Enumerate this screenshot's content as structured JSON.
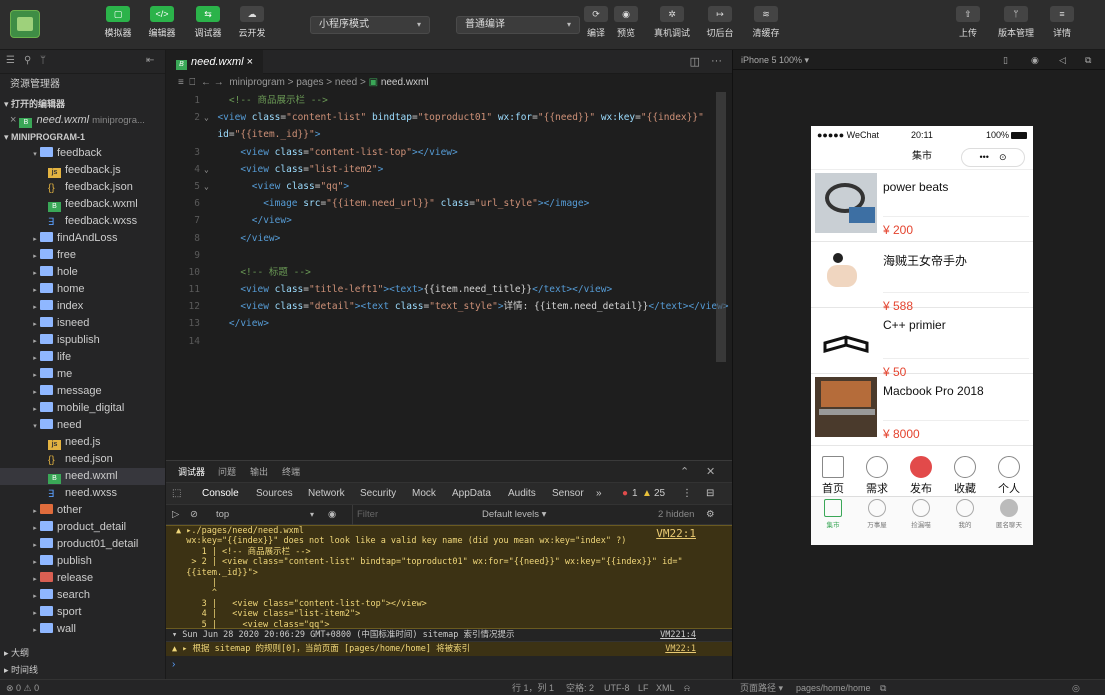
{
  "toolbar": {
    "buttons": [
      "模拟器",
      "编辑器",
      "调试器",
      "云开发"
    ],
    "mode_select": "小程序模式",
    "compile_select": "普通编译",
    "right_buttons": [
      "编译",
      "预览",
      "真机调试",
      "切后台",
      "清缓存"
    ],
    "far_right": [
      "上传",
      "版本管理",
      "详情"
    ]
  },
  "sidebar": {
    "title": "资源管理器",
    "open_editors": "打开的编辑器",
    "open_file": "need.wxml",
    "open_file_path": "miniprogra...",
    "project": "MINIPROGRAM-1",
    "tree": [
      {
        "label": "feedback",
        "kind": "folder",
        "arrow": "▾",
        "depth": 1
      },
      {
        "label": "feedback.js",
        "kind": "js",
        "depth": 2
      },
      {
        "label": "feedback.json",
        "kind": "json",
        "depth": 2
      },
      {
        "label": "feedback.wxml",
        "kind": "wxml",
        "depth": 2
      },
      {
        "label": "feedback.wxss",
        "kind": "wxss",
        "depth": 2
      },
      {
        "label": "findAndLoss",
        "kind": "folder",
        "arrow": "▸",
        "depth": 1
      },
      {
        "label": "free",
        "kind": "folder",
        "arrow": "▸",
        "depth": 1
      },
      {
        "label": "hole",
        "kind": "folder",
        "arrow": "▸",
        "depth": 1
      },
      {
        "label": "home",
        "kind": "folder",
        "arrow": "▸",
        "depth": 1
      },
      {
        "label": "index",
        "kind": "folder",
        "arrow": "▸",
        "depth": 1
      },
      {
        "label": "isneed",
        "kind": "folder",
        "arrow": "▸",
        "depth": 1
      },
      {
        "label": "ispublish",
        "kind": "folder",
        "arrow": "▸",
        "depth": 1
      },
      {
        "label": "life",
        "kind": "folder",
        "arrow": "▸",
        "depth": 1
      },
      {
        "label": "me",
        "kind": "folder",
        "arrow": "▸",
        "depth": 1
      },
      {
        "label": "message",
        "kind": "folder",
        "arrow": "▸",
        "depth": 1
      },
      {
        "label": "mobile_digital",
        "kind": "folder",
        "arrow": "▸",
        "depth": 1
      },
      {
        "label": "need",
        "kind": "folder",
        "arrow": "▾",
        "depth": 1
      },
      {
        "label": "need.js",
        "kind": "js",
        "depth": 2
      },
      {
        "label": "need.json",
        "kind": "json",
        "depth": 2
      },
      {
        "label": "need.wxml",
        "kind": "wxml",
        "depth": 2,
        "selected": true
      },
      {
        "label": "need.wxss",
        "kind": "wxss",
        "depth": 2
      },
      {
        "label": "other",
        "kind": "other",
        "arrow": "▸",
        "depth": 1
      },
      {
        "label": "product_detail",
        "kind": "folder",
        "arrow": "▸",
        "depth": 1
      },
      {
        "label": "product01_detail",
        "kind": "folder",
        "arrow": "▸",
        "depth": 1
      },
      {
        "label": "publish",
        "kind": "folder",
        "arrow": "▸",
        "depth": 1
      },
      {
        "label": "release",
        "kind": "release",
        "arrow": "▸",
        "depth": 1
      },
      {
        "label": "search",
        "kind": "folder",
        "arrow": "▸",
        "depth": 1
      },
      {
        "label": "sport",
        "kind": "folder",
        "arrow": "▸",
        "depth": 1
      },
      {
        "label": "wall",
        "kind": "folder",
        "arrow": "▸",
        "depth": 1
      }
    ],
    "outline": "大纲",
    "timeline": "时间线"
  },
  "editor": {
    "tab": "need.wxml",
    "breadcrumb": "miniprogram > pages > need > ",
    "breadcrumb_file": "need.wxml",
    "line_numbers": [
      "1",
      "2",
      "",
      "3",
      "4",
      "5",
      "6",
      "7",
      "8",
      "9",
      "10",
      "11",
      "12",
      "13",
      "14"
    ]
  },
  "console": {
    "panel_tabs": [
      "调试器",
      "问题",
      "输出",
      "终端"
    ],
    "devtabs": [
      "Console",
      "Sources",
      "Network",
      "Security",
      "Mock",
      "AppData",
      "Audits",
      "Sensor",
      "»"
    ],
    "errors": "1",
    "warnings": "25",
    "context": "top",
    "filter_placeholder": "Filter",
    "levels": "Default levels ▾",
    "hidden": "2 hidden",
    "warn_lines": [
      "▲ ▸./pages/need/need.wxml",
      "  wx:key=\"{{index}}\" does not look like a valid key name (did you mean wx:key=\"index\" ?)",
      "     1 | <!-- 商品展示栏 -->",
      "   > 2 | <view class=\"content-list\" bindtap=\"toproduct01\" wx:for=\"{{need}}\" wx:key=\"{{index}}\" id=\"",
      "  {{item._id}}\">",
      "       |",
      "       ^",
      "     3 |   <view class=\"content-list-top\"></view>",
      "     4 |   <view class=\"list-item2\">",
      "     5 |     <view class=\"qq\">"
    ],
    "vm1": "VM22:1",
    "log_line": "▾ Sun Jun 28 2020 20:06:29 GMT+0800 (中国标准时间) sitemap 索引情况提示",
    "vm2": "VM221:4",
    "warn2": "▲ ▸ 根据 sitemap 的规则[0]，当前页面 [pages/home/home] 将被索引",
    "vm3": "VM22:1"
  },
  "simulator": {
    "device": "iPhone 5 100% ▾",
    "carrier": "●●●●● WeChat",
    "time": "20:11",
    "battery": "100%",
    "nav_title": "集市",
    "items": [
      {
        "name": "power beats",
        "price": "¥ 200"
      },
      {
        "name": "海贼王女帝手办",
        "price": "¥ 588"
      },
      {
        "name": "C++ primier",
        "price": "¥ 50"
      },
      {
        "name": "Macbook Pro 2018",
        "price": "¥ 8000"
      }
    ],
    "tabs1": [
      "首页",
      "需求",
      "发布",
      "收藏",
      "个人"
    ],
    "tabs2": [
      "集市",
      "万事屋",
      "捡漏喵",
      "我的",
      "匿名聊天"
    ]
  },
  "statusbar": {
    "problems": "⊗ 0 ⚠ 0",
    "cursor": "行 1，列 1",
    "spaces": "空格: 2",
    "encoding": "UTF-8",
    "eol": "LF",
    "lang": "XML",
    "page_path_label": "页面路径 ▾",
    "page_path": "pages/home/home"
  },
  "colors": {
    "accent": "#2bb34a",
    "price": "#e4442f",
    "warning_bg": "#3c3214"
  }
}
